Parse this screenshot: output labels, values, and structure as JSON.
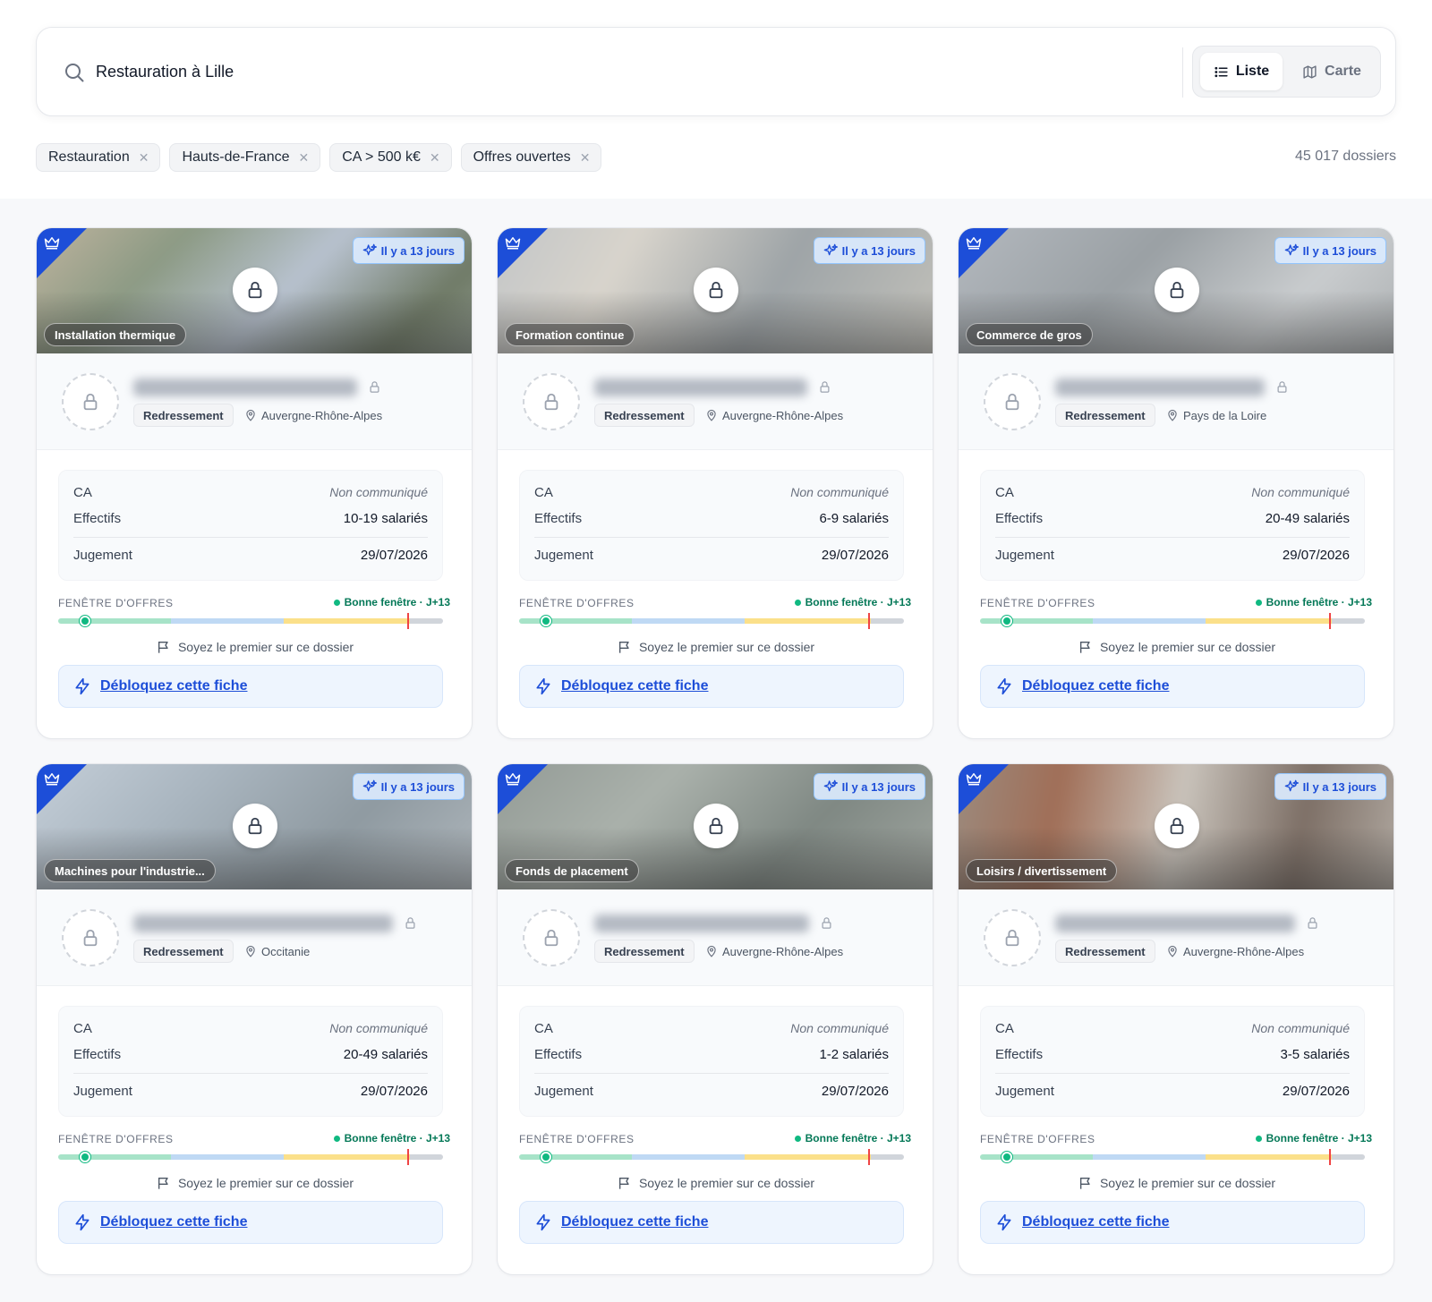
{
  "search": {
    "query": "Restauration à Lille"
  },
  "view_toggle": {
    "list_label": "Liste",
    "map_label": "Carte",
    "active": "Liste"
  },
  "filters": [
    {
      "label": "Restauration"
    },
    {
      "label": "Hauts-de-France"
    },
    {
      "label": "CA > 500 k€"
    },
    {
      "label": "Offres ouvertes"
    }
  ],
  "result_count": "45 017 dossiers",
  "common": {
    "time_badge": "Il y a 13 jours",
    "status": "Redressement",
    "ca_label": "CA",
    "ca_value": "Non communiqué",
    "effectifs_label": "Effectifs",
    "jugement_label": "Jugement",
    "window_label": "FENÊTRE D'OFFRES",
    "window_status": "Bonne fenêtre · J+13",
    "window_progress_fraction": 0.07,
    "window_deadline_fraction": 0.91,
    "first_note": "Soyez le premier sur ce dossier",
    "unlock_label": "Débloquez cette fiche"
  },
  "colors": {
    "accent": "#1d4ed8",
    "success": "#10b981",
    "deadline": "#ef4444"
  },
  "cards": [
    {
      "category": "Installation thermique",
      "location": "Auvergne-Rhône-Alpes",
      "effectifs": "10-19 salariés",
      "jugement": "29/07/2026"
    },
    {
      "category": "Formation continue",
      "location": "Auvergne-Rhône-Alpes",
      "effectifs": "6-9 salariés",
      "jugement": "29/07/2026"
    },
    {
      "category": "Commerce de gros",
      "location": "Pays de la Loire",
      "effectifs": "20-49 salariés",
      "jugement": "29/07/2026"
    },
    {
      "category": "Machines pour l'industrie...",
      "location": "Occitanie",
      "effectifs": "20-49 salariés",
      "jugement": "29/07/2026"
    },
    {
      "category": "Fonds de placement",
      "location": "Auvergne-Rhône-Alpes",
      "effectifs": "1-2 salariés",
      "jugement": "29/07/2026"
    },
    {
      "category": "Loisirs / divertissement",
      "location": "Auvergne-Rhône-Alpes",
      "effectifs": "3-5 salariés",
      "jugement": "29/07/2026"
    }
  ]
}
